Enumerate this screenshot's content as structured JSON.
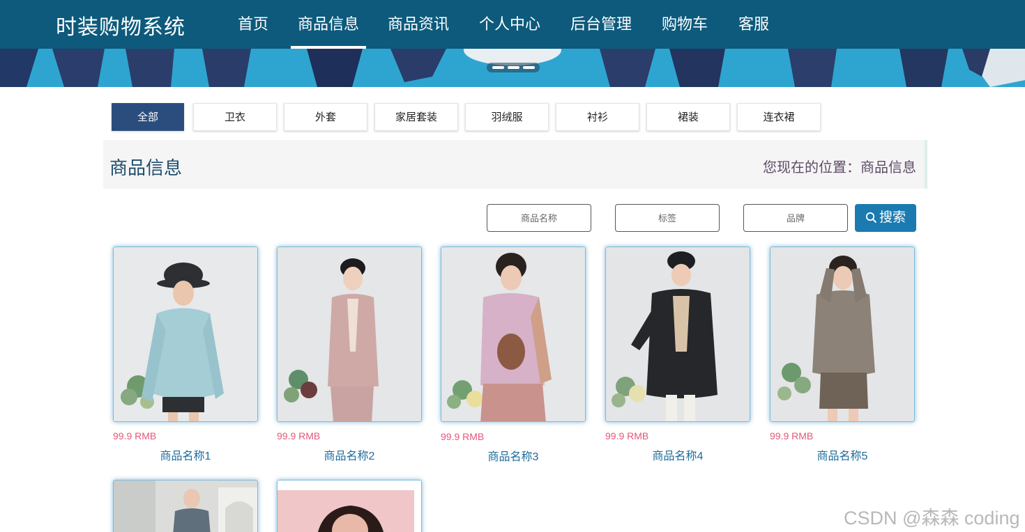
{
  "header": {
    "brand": "时装购物系统",
    "nav": [
      {
        "label": "首页",
        "active": false
      },
      {
        "label": "商品信息",
        "active": true
      },
      {
        "label": "商品资讯",
        "active": false
      },
      {
        "label": "个人中心",
        "active": false
      },
      {
        "label": "后台管理",
        "active": false
      },
      {
        "label": "购物车",
        "active": false
      },
      {
        "label": "客服",
        "active": false
      }
    ]
  },
  "categories": [
    "全部",
    "卫衣",
    "外套",
    "家居套装",
    "羽绒服",
    "衬衫",
    "裙装",
    "连衣裙"
  ],
  "active_category": "全部",
  "title_bar": {
    "title": "商品信息",
    "location": "您现在的位置：商品信息"
  },
  "search": {
    "name_placeholder": "商品名称",
    "tag_placeholder": "标签",
    "brand_placeholder": "品牌",
    "button_label": "搜索"
  },
  "products": [
    {
      "price": "99.9 RMB",
      "name": "商品名称1",
      "garment": "light blue hoodie",
      "color": "#a4cdd6"
    },
    {
      "price": "99.9 RMB",
      "name": "商品名称2",
      "garment": "pink blazer",
      "color": "#cfa9a6"
    },
    {
      "price": "99.9 RMB",
      "name": "商品名称3",
      "garment": "pink sweatshirt",
      "color": "#d6b1c7"
    },
    {
      "price": "99.9 RMB",
      "name": "商品名称4",
      "garment": "black down jacket",
      "color": "#25272b"
    },
    {
      "price": "99.9 RMB",
      "name": "商品名称5",
      "garment": "taupe knit hoodie",
      "color": "#8d8278"
    }
  ],
  "partial_products": [
    {
      "garment": "grey jacket",
      "color": "#5f6f7c"
    },
    {
      "garment": "pink backdrop portrait",
      "color": "#f0c6c8"
    }
  ],
  "watermark": "CSDN @森森 coding",
  "theme": {
    "nav_bg": "#0d5a7c",
    "active_tab": "#2a4d7e",
    "search_button": "#1b7bb0",
    "price_color": "#e45778",
    "name_color": "#1a6b9b"
  }
}
